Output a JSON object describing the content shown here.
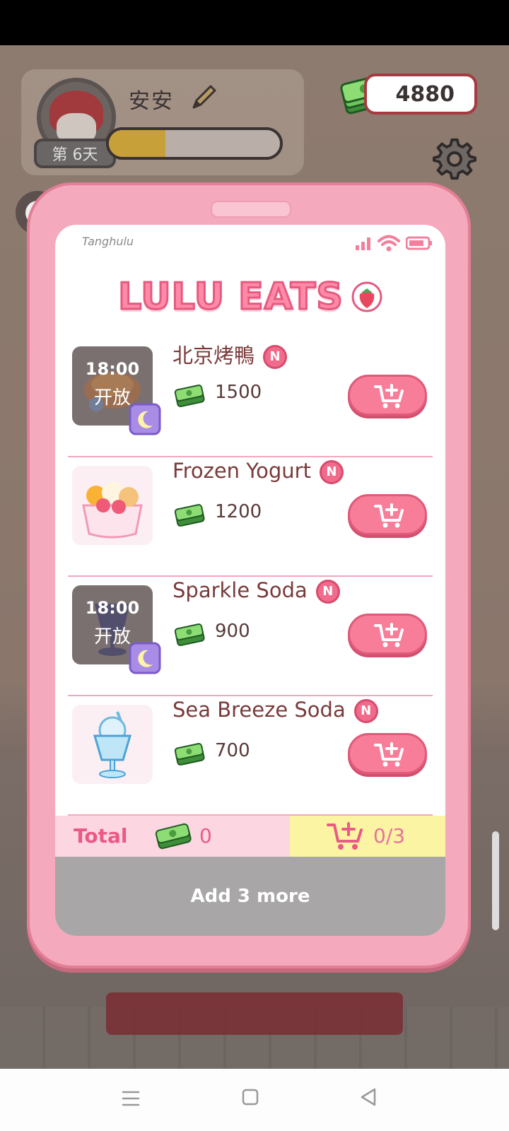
{
  "hud": {
    "player_name": "安安",
    "day_label": "第 6天",
    "money": "4880",
    "xp_progress": 0.33
  },
  "phone": {
    "status_app": "Tanghulu",
    "logo_text": "LULU EATS",
    "items": [
      {
        "name": "北京烤鴨",
        "badge": "N",
        "price": "1500",
        "locked": true,
        "lock_time": "18:00",
        "lock_text": "开放",
        "icon": "roast-duck-icon"
      },
      {
        "name": "Frozen Yogurt",
        "badge": "N",
        "price": "1200",
        "locked": false,
        "icon": "frozen-yogurt-icon"
      },
      {
        "name": "Sparkle Soda",
        "badge": "N",
        "price": "900",
        "locked": true,
        "lock_time": "18:00",
        "lock_text": "开放",
        "icon": "sparkle-soda-icon"
      },
      {
        "name": "Sea Breeze Soda",
        "badge": "N",
        "price": "700",
        "locked": false,
        "icon": "sea-breeze-soda-icon"
      }
    ],
    "total_label": "Total",
    "total_value": "0",
    "cart_count": "0/3",
    "add_more_label": "Add 3 more"
  },
  "colors": {
    "accent_pink": "#f77d99",
    "phone_body": "#f4a9bd",
    "total_bg": "#fcd6e1",
    "cart_bg": "#fbf4a3",
    "disabled_button": "#a8a6a6"
  }
}
